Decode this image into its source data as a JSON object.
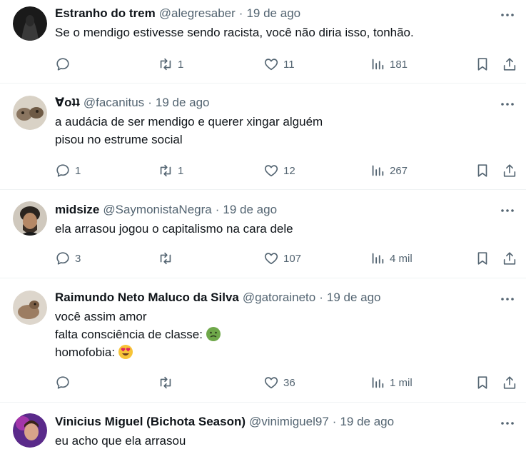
{
  "tweets": [
    {
      "name": "Estranho do trem",
      "handle": "@alegresaber",
      "date": "19 de ago",
      "lines": [
        "Se o mendigo estivesse sendo racista, você não diria isso, tonhão."
      ],
      "replies": "",
      "retweets": "1",
      "likes": "11",
      "views": "181"
    },
    {
      "name": "Ɐoʇʇ",
      "handle": "@facanitus",
      "date": "19 de ago",
      "lines": [
        "a audácia de ser mendigo e querer xingar alguém",
        "pisou no estrume social"
      ],
      "replies": "1",
      "retweets": "1",
      "likes": "12",
      "views": "267"
    },
    {
      "name": "midsize",
      "handle": "@SaymonistaNegra",
      "date": "19 de ago",
      "lines": [
        "ela arrasou jogou o capitalismo na cara dele"
      ],
      "replies": "3",
      "retweets": "",
      "likes": "107",
      "views": "4 mil"
    },
    {
      "name": "Raimundo Neto Maluco da Silva",
      "handle": "@gatoraineto",
      "date": "19 de ago",
      "lines": [
        "você assim amor",
        "falta consciência de classe:",
        "homofobia:"
      ],
      "emojis": [
        "nauseated-face",
        "heart-eyes-face"
      ],
      "replies": "",
      "retweets": "",
      "likes": "36",
      "views": "1 mil"
    },
    {
      "name": "Vinicius Miguel (Bichota Season)",
      "handle": "@vinimiguel97",
      "date": "19 de ago",
      "lines": [
        "eu acho que ela arrasou"
      ]
    }
  ],
  "separator": "·",
  "colors": {
    "text": "#0f1419",
    "secondary": "#536471",
    "divider": "#eff3f4"
  }
}
